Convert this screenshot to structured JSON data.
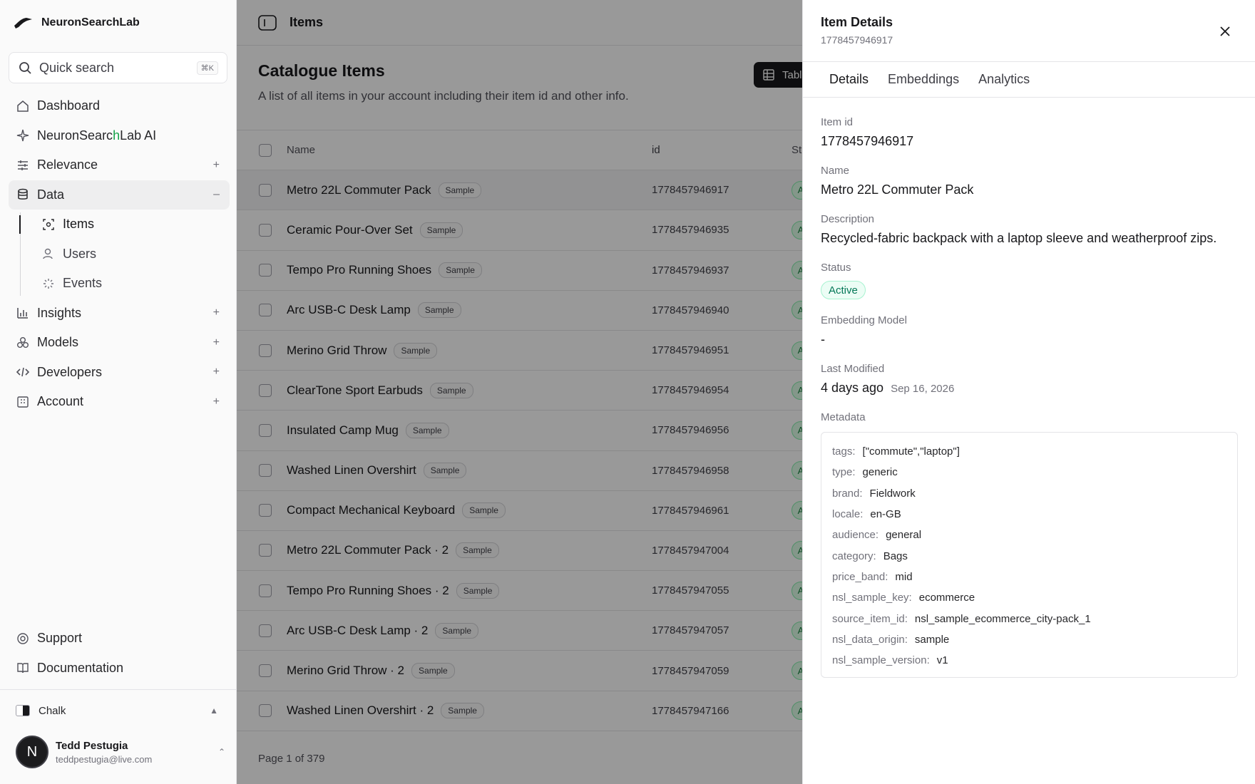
{
  "app": {
    "name": "NeuronSearchLab"
  },
  "search": {
    "label": "Quick search",
    "shortcut": "⌘K"
  },
  "nav": {
    "dashboard": "Dashboard",
    "ai_prefix": "NeuronSearc",
    "ai_highlight": "h",
    "ai_suffix": "Lab AI",
    "relevance": "Relevance",
    "data": "Data",
    "items": "Items",
    "users": "Users",
    "events": "Events",
    "insights": "Insights",
    "models": "Models",
    "developers": "Developers",
    "account": "Account",
    "support": "Support",
    "documentation": "Documentation",
    "plus": "+",
    "minus": "–"
  },
  "workspace": {
    "name": "Chalk"
  },
  "user": {
    "initial": "N",
    "name": "Tedd Pestugia",
    "email": "teddpestugia@live.com"
  },
  "topbar": {
    "title": "Items"
  },
  "page": {
    "title": "Catalogue Items",
    "subtitle": "A list of all items in your account including their item id and other info.",
    "view_toggle": "Table"
  },
  "table": {
    "columns": {
      "name": "Name",
      "id": "id",
      "status": "St"
    },
    "badge": "Sample",
    "status_glyph": "A",
    "rows": [
      {
        "name": "Metro 22L Commuter Pack",
        "id": "1778457946917"
      },
      {
        "name": "Ceramic Pour-Over Set",
        "id": "1778457946935"
      },
      {
        "name": "Tempo Pro Running Shoes",
        "id": "1778457946937"
      },
      {
        "name": "Arc USB-C Desk Lamp",
        "id": "1778457946940"
      },
      {
        "name": "Merino Grid Throw",
        "id": "1778457946951"
      },
      {
        "name": "ClearTone Sport Earbuds",
        "id": "1778457946954"
      },
      {
        "name": "Insulated Camp Mug",
        "id": "1778457946956"
      },
      {
        "name": "Washed Linen Overshirt",
        "id": "1778457946958"
      },
      {
        "name": "Compact Mechanical Keyboard",
        "id": "1778457946961"
      },
      {
        "name": "Metro 22L Commuter Pack · 2",
        "id": "1778457947004"
      },
      {
        "name": "Tempo Pro Running Shoes · 2",
        "id": "1778457947055"
      },
      {
        "name": "Arc USB-C Desk Lamp · 2",
        "id": "1778457947057"
      },
      {
        "name": "Merino Grid Throw · 2",
        "id": "1778457947059"
      },
      {
        "name": "Washed Linen Overshirt · 2",
        "id": "1778457947166"
      }
    ]
  },
  "pagination": {
    "label": "Page 1 of 379"
  },
  "drawer": {
    "title": "Item Details",
    "subtitle": "1778457946917",
    "tabs": [
      "Details",
      "Embeddings",
      "Analytics"
    ],
    "fields": {
      "item_id_label": "Item id",
      "item_id": "1778457946917",
      "name_label": "Name",
      "name": "Metro 22L Commuter Pack",
      "description_label": "Description",
      "description": "Recycled-fabric backpack with a laptop sleeve and weatherproof zips.",
      "status_label": "Status",
      "status": "Active",
      "embedding_label": "Embedding Model",
      "embedding": "-",
      "modified_label": "Last Modified",
      "modified_relative": "4 days ago",
      "modified_date": "Sep 16, 2026",
      "metadata_label": "Metadata"
    },
    "metadata": [
      {
        "key": "tags:",
        "value": "[\"commute\",\"laptop\"]"
      },
      {
        "key": "type:",
        "value": "generic"
      },
      {
        "key": "brand:",
        "value": "Fieldwork"
      },
      {
        "key": "locale:",
        "value": "en-GB"
      },
      {
        "key": "audience:",
        "value": "general"
      },
      {
        "key": "category:",
        "value": "Bags"
      },
      {
        "key": "price_band:",
        "value": "mid"
      },
      {
        "key": "nsl_sample_key:",
        "value": "ecommerce"
      },
      {
        "key": "source_item_id:",
        "value": "nsl_sample_ecommerce_city-pack_1"
      },
      {
        "key": "nsl_data_origin:",
        "value": "sample"
      },
      {
        "key": "nsl_sample_version:",
        "value": "v1"
      }
    ]
  },
  "colors": {
    "accent": "#16a34a",
    "status_active": "#047857",
    "overlay": "rgba(0,0,0,0.40)"
  }
}
